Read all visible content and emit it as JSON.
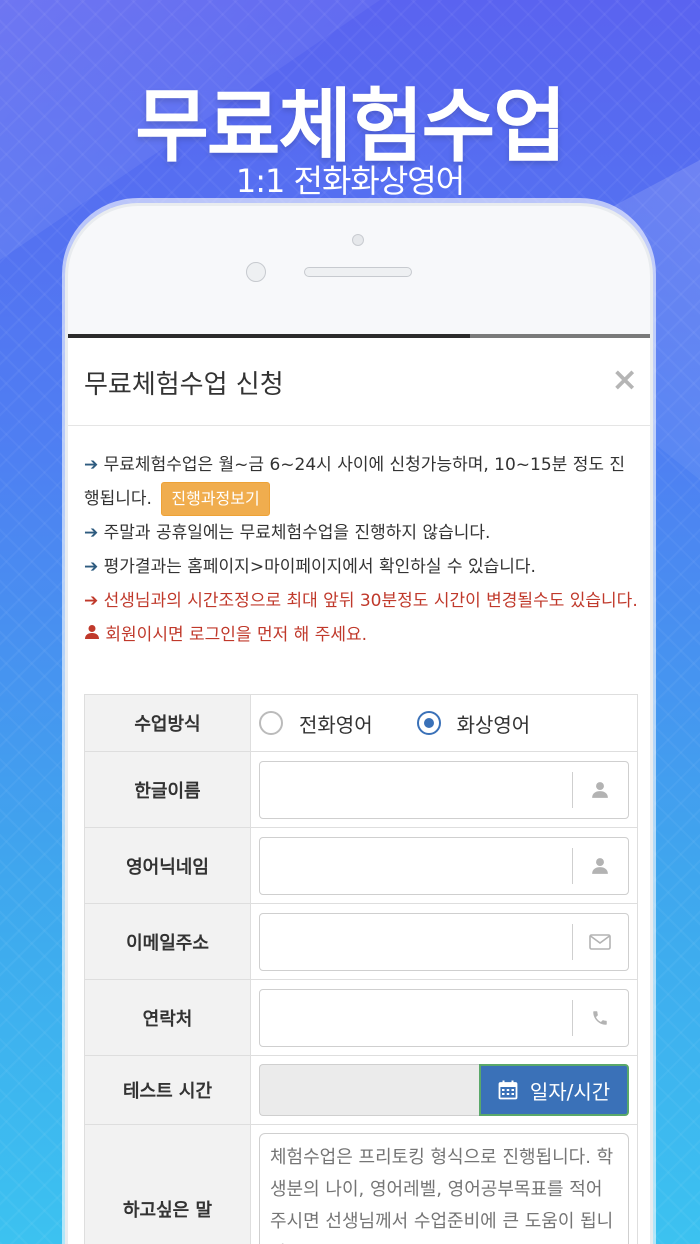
{
  "hero": {
    "title": "무료체험수업",
    "subtitle": "1:1 전화화상영어"
  },
  "modal": {
    "title": "무료체험수업 신청",
    "close": "×"
  },
  "notices": [
    {
      "text": "무료체험수업은 월~금 6~24시 사이에 신청가능하며, 10~15분 정도 진행됩니다.",
      "color": "#333333"
    },
    {
      "text": "주말과 공휴일에는 무료체험수업을 진행하지 않습니다.",
      "color": "#333333"
    },
    {
      "text": "평가결과는 홈페이지>마이페이지에서 확인하실 수 있습니다.",
      "color": "#333333"
    },
    {
      "text": "선생님과의 시간조정으로 최대 앞뒤 30분정도 시간이 변경될수도 있습니다.",
      "color": "#c0392b"
    },
    {
      "text": "회원이시면 로그인을 먼저 해 주세요.",
      "color": "#c0392b"
    }
  ],
  "process_button": "진행과정보기",
  "form": {
    "method_label": "수업방식",
    "method_options": [
      "전화영어",
      "화상영어"
    ],
    "method_selected": "화상영어",
    "korean_name_label": "한글이름",
    "korean_name_value": "",
    "english_nick_label": "영어닉네임",
    "english_nick_value": "",
    "email_label": "이메일주소",
    "email_value": "",
    "phone_label": "연락처",
    "phone_value": "",
    "test_time_label": "테스트 시간",
    "test_time_value": "",
    "date_button": "일자/시간",
    "message_label": "하고싶은 말",
    "message_placeholder": "체험수업은 프리토킹 형식으로 진행됩니다. 학생분의 나이, 영어레벨, 영어공부목표를 적어주시면 선생님께서 수업준비에 큰 도움이 됩니다."
  },
  "icons": {
    "arrow": "arrow-right-icon",
    "user": "user-icon",
    "envelope": "envelope-icon",
    "phone": "phone-icon",
    "calendar": "calendar-icon"
  },
  "colors": {
    "primary": "#3a71b8",
    "warning": "#f0ad4e",
    "danger": "#c0392b",
    "arrow": "#2e5b7f"
  }
}
